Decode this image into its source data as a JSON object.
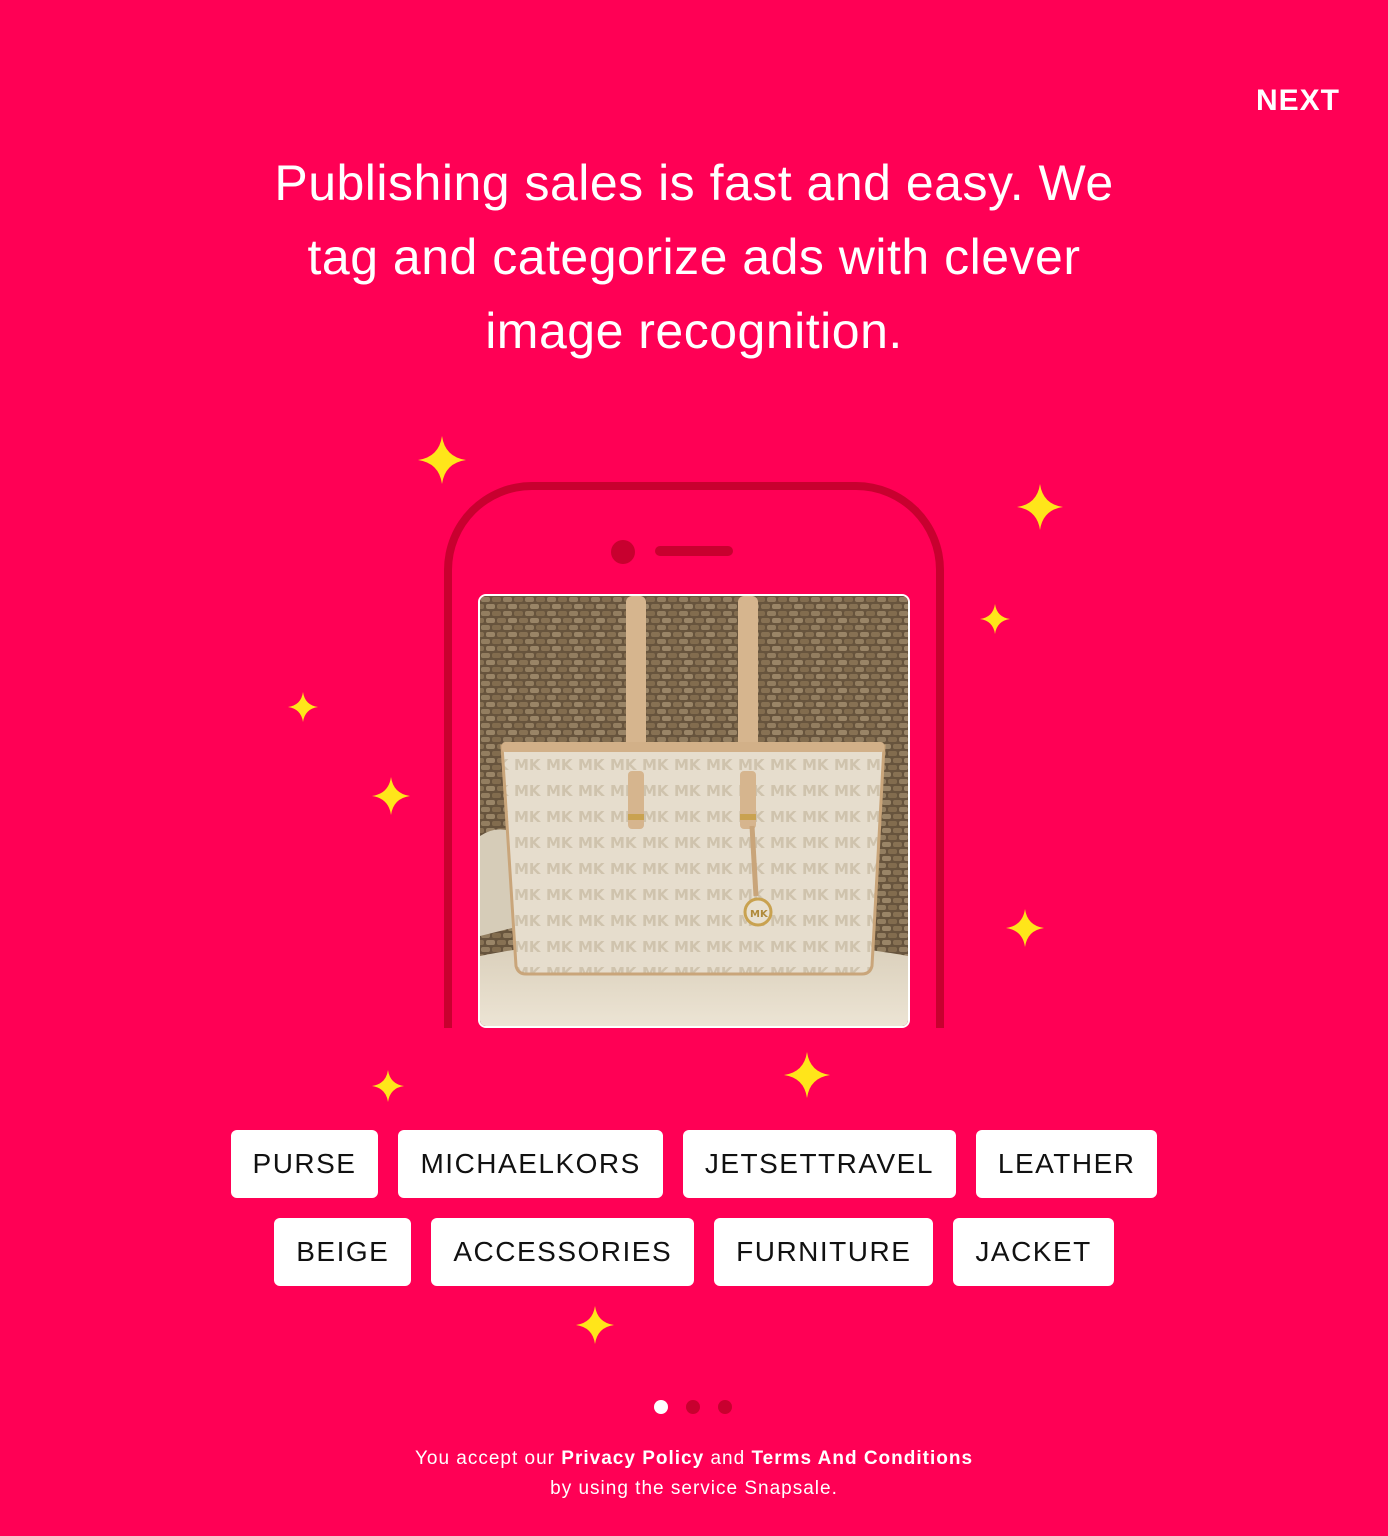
{
  "header": {
    "next_label": "NEXT"
  },
  "headline": {
    "line1": "Publishing sales is fast and easy. We",
    "line2": "tag and categorize ads with clever",
    "line3": "image recognition."
  },
  "colors": {
    "background": "#ff0055",
    "phone_outline": "#c8002f",
    "sparkle": "#ffe51a",
    "tag_background": "#ffffff",
    "tag_text": "#111111"
  },
  "tags": {
    "row1": [
      "PURSE",
      "MICHAELKORS",
      "JETSETTRAVEL",
      "LEATHER"
    ],
    "row2": [
      "BEIGE",
      "ACCESSORIES",
      "FURNITURE",
      "JACKET"
    ]
  },
  "pagination": {
    "total": 3,
    "active": 1
  },
  "footer": {
    "prefix": "You accept our",
    "privacy_link": "Privacy Policy",
    "conjunction": "and",
    "terms_link": "Terms And Conditions",
    "line2": "by using the service Snapsale."
  },
  "photo": {
    "subject": "handbag-photo",
    "bag_logo": "MK"
  }
}
